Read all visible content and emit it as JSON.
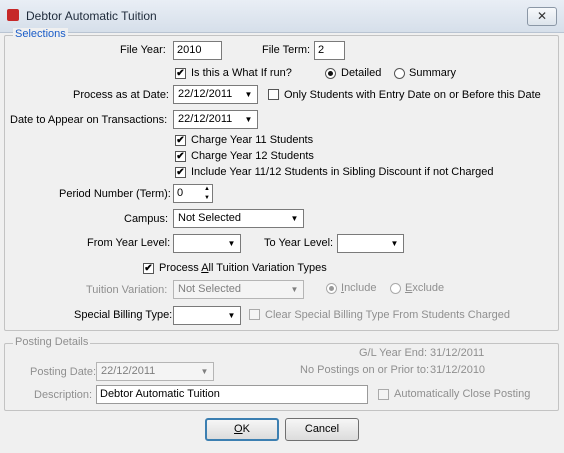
{
  "window": {
    "title": "Debtor Automatic Tuition",
    "close_glyph": "✕",
    "icon": "app-icon"
  },
  "selections": {
    "legend": "Selections",
    "file_year_label": "File Year:",
    "file_year_value": "2010",
    "file_term_label": "File Term:",
    "file_term_value": "2",
    "what_if_label": "Is this a What If run?",
    "what_if_checked": true,
    "detailed_label": "Detailed",
    "summary_label": "Summary",
    "report_mode": "Detailed",
    "process_date_label": "Process as at Date:",
    "process_date_value": "22/12/2011",
    "only_students_label": "Only Students with  Entry Date on or Before this Date",
    "only_students_checked": false,
    "transaction_date_label": "Date to Appear on Transactions:",
    "transaction_date_value": "22/12/2011",
    "charge_year11_label": "Charge Year 11 Students",
    "charge_year11_checked": true,
    "charge_year12_label": "Charge Year 12 Students",
    "charge_year12_checked": true,
    "include_sibling_label": "Include Year 11/12 Students in Sibling Discount if not Charged",
    "include_sibling_checked": true,
    "period_number_label": "Period Number (Term):",
    "period_number_value": "0",
    "campus_label": "Campus:",
    "campus_value": "Not Selected",
    "from_year_label": "From Year Level:",
    "from_year_value": "",
    "to_year_label": "To Year Level:",
    "to_year_value": "",
    "process_all_label_pre": "Process ",
    "process_all_label_u": "A",
    "process_all_label_post": "ll Tuition Variation Types",
    "process_all_checked": true,
    "tuition_variation_label": "Tuition Variation:",
    "tuition_variation_value": "Not Selected",
    "include_label_u": "I",
    "include_label_rest": "nclude",
    "exclude_label_u": "E",
    "exclude_label_rest": "xclude",
    "variation_mode": "Include",
    "special_billing_label": "Special Billing Type:",
    "special_billing_value": "",
    "clear_special_label": "Clear Special Billing Type From Students Charged",
    "clear_special_checked": false
  },
  "posting": {
    "legend": "Posting  Details",
    "gl_year_end_label": "G/L Year End:",
    "gl_year_end_value": "31/12/2011",
    "no_postings_label": "No Postings on or Prior to:",
    "no_postings_value": "31/12/2010",
    "posting_date_label": "Posting Date:",
    "posting_date_value": "22/12/2011",
    "description_label": "Description:",
    "description_value": "Debtor Automatic Tuition",
    "auto_close_label": "Automatically Close Posting",
    "auto_close_checked": false
  },
  "buttons": {
    "ok_u": "O",
    "ok_rest": "K",
    "cancel": "Cancel"
  },
  "glyphs": {
    "check": "✔",
    "arrow_down": "▼",
    "spin_up": "▲",
    "spin_down": "▼"
  }
}
